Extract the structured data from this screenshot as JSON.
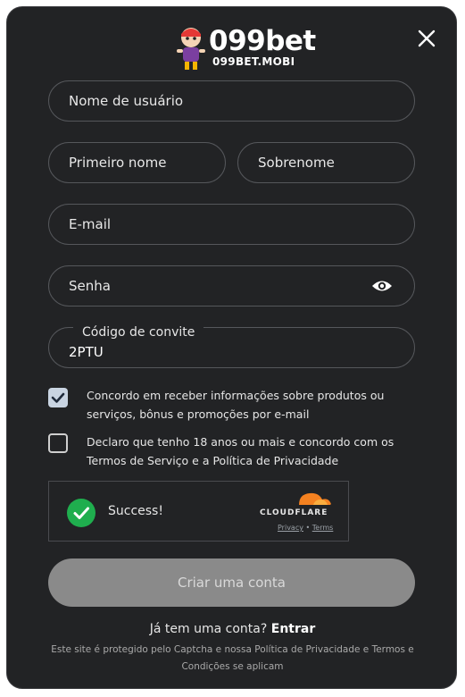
{
  "brand": {
    "name": "099bet",
    "domain": "099BET.MOBI"
  },
  "form": {
    "username_placeholder": "Nome de usuário",
    "first_name_placeholder": "Primeiro nome",
    "last_name_placeholder": "Sobrenome",
    "email_placeholder": "E-mail",
    "password_placeholder": "Senha",
    "invite_label": "Código de convite",
    "invite_value": "2PTU"
  },
  "consents": [
    {
      "checked": true,
      "label": "Concordo em receber informações sobre produtos ou serviços, bônus e promoções por e-mail"
    },
    {
      "checked": false,
      "label": "Declaro que tenho 18 anos ou mais e concordo com os Termos de Serviço e a Política de Privacidade"
    }
  ],
  "captcha": {
    "status": "Success!",
    "provider": "CLOUDFLARE",
    "privacy_link": "Privacy",
    "separator": "•",
    "terms_link": "Terms"
  },
  "submit_label": "Criar uma conta",
  "login": {
    "prompt": "Já tem uma conta?",
    "link": "Entrar"
  },
  "footer_note": "Este site é protegido pelo Captcha e nossa Política de Privacidade e Termos e Condições se aplicam",
  "colors": {
    "background": "#222325",
    "field_border": "#55575b",
    "button": "#8a8a8a",
    "success": "#1fae4e",
    "cloudflare": "#f48120"
  },
  "icons": [
    "close-icon",
    "eye-icon",
    "checkmark-icon",
    "success-check-icon",
    "cloudflare-icon",
    "mascot-icon"
  ]
}
